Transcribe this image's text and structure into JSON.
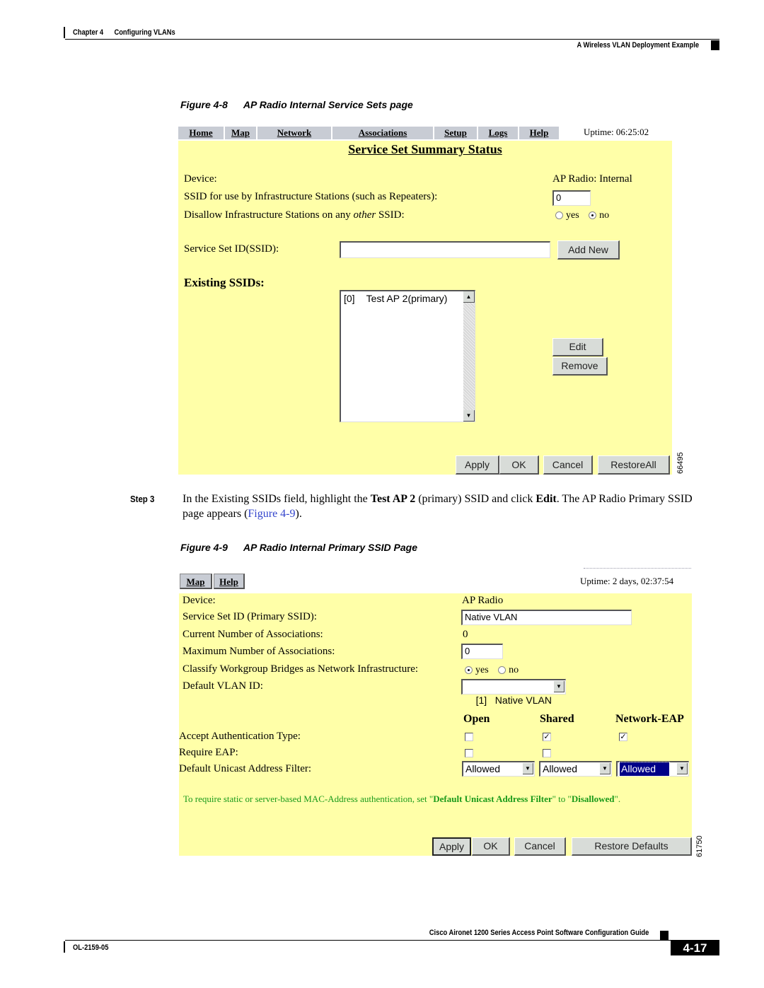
{
  "page_header": {
    "chapter_label": "Chapter 4",
    "chapter_title": "Configuring VLANs",
    "section_title": "A Wireless VLAN Deployment Example"
  },
  "figure_8": {
    "caption_number": "Figure 4-8",
    "caption_title": "AP Radio Internal Service Sets page",
    "figure_id": "66495",
    "nav": {
      "items": [
        "Home",
        "Map",
        "Network",
        "Associations",
        "Setup",
        "Logs",
        "Help"
      ],
      "uptime": "Uptime: 06:25:02"
    },
    "title": "Service Set Summary Status",
    "device_label": "Device:",
    "device_value": "AP Radio: Internal",
    "infra_ssid_label": "SSID for use by Infrastructure Stations (such as Repeaters):",
    "infra_ssid_value": "0",
    "disallow_label_pre": "Disallow Infrastructure Stations on any ",
    "disallow_label_em": "other",
    "disallow_label_post": " SSID:",
    "disallow_options": [
      "yes",
      "no"
    ],
    "disallow_selected": "no",
    "ssid_label": "Service Set ID(SSID):",
    "ssid_value": "",
    "add_new_button": "Add New",
    "existing_label": "Existing SSIDs:",
    "existing_list": [
      {
        "index": "[0]",
        "name": "Test AP 2(primary)"
      }
    ],
    "edit_button": "Edit",
    "remove_button": "Remove",
    "buttons": {
      "apply": "Apply",
      "ok": "OK",
      "cancel": "Cancel",
      "restore": "RestoreAll"
    }
  },
  "step": {
    "label": "Step 3",
    "text_1": "In the Existing SSIDs field, highlight the ",
    "bold_1": "Test AP 2",
    "text_2": " (primary) SSID and click ",
    "bold_2": "Edit",
    "text_3": ". The AP Radio Primary SSID page appears (",
    "link": "Figure 4-9",
    "text_4": ")."
  },
  "figure_9": {
    "caption_number": "Figure 4-9",
    "caption_title": "AP Radio Internal Primary SSID Page",
    "figure_id": "61750",
    "nav": {
      "items": [
        "Map",
        "Help"
      ],
      "uptime": "Uptime: 2 days, 02:37:54"
    },
    "device_label": "Device:",
    "device_value": "AP Radio",
    "ssid_label": "Service Set ID (Primary SSID):",
    "ssid_value": "Native VLAN",
    "current_assoc_label": "Current Number of Associations:",
    "current_assoc_value": "0",
    "max_assoc_label": "Maximum Number of Associations:",
    "max_assoc_value": "0",
    "classify_label": "Classify Workgroup Bridges as Network Infrastructure:",
    "classify_options": [
      "yes",
      "no"
    ],
    "classify_selected": "yes",
    "vlan_label": "Default VLAN ID:",
    "vlan_value": "[1]   Native VLAN",
    "auth_columns": [
      "Open",
      "Shared",
      "Network-EAP"
    ],
    "accept_auth_label": "Accept Authentication Type:",
    "accept_auth": [
      false,
      true,
      true
    ],
    "require_eap_label": "Require EAP:",
    "require_eap": [
      false,
      false
    ],
    "unicast_filter_label": "Default Unicast Address Filter:",
    "unicast_filter": [
      "Allowed",
      "Allowed",
      "Allowed"
    ],
    "note_pre": "To require static or server-based MAC-Address authentication, set \"",
    "note_bold_1": "Default Unicast Address Filter",
    "note_mid": "\" to \"",
    "note_bold_2": "Disallowed",
    "note_post": "\".",
    "note_color": "#1a9a1a",
    "buttons": {
      "apply": "Apply",
      "ok": "OK",
      "cancel": "Cancel",
      "restore": "Restore Defaults"
    }
  },
  "page_footer": {
    "guide_title": "Cisco Aironet 1200 Series Access Point Software Configuration Guide",
    "doc_number": "OL-2159-05",
    "page_number": "4-17"
  }
}
